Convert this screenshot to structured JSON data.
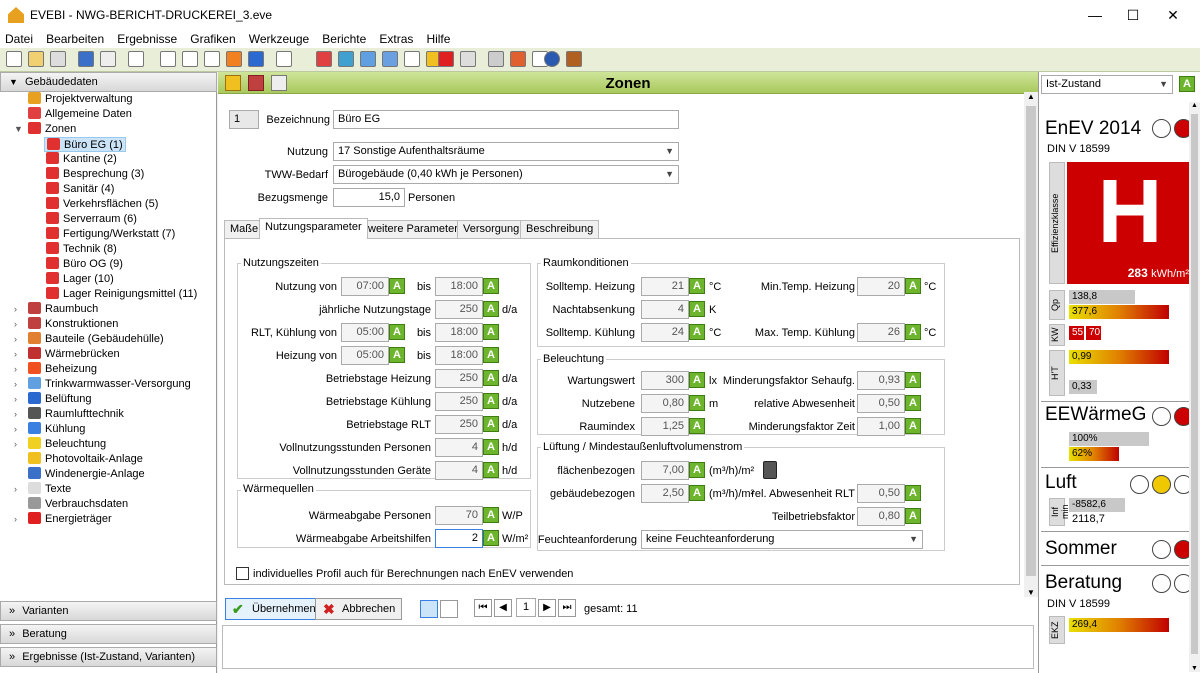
{
  "app": {
    "title": "EVEBI - NWG-BERICHT-DRUCKEREI_3.eve"
  },
  "menu": [
    "Datei",
    "Bearbeiten",
    "Ergebnisse",
    "Grafiken",
    "Werkzeuge",
    "Berichte",
    "Extras",
    "Hilfe"
  ],
  "sidebar": {
    "header": "Gebäudedaten",
    "tree": [
      "Projektverwaltung",
      "Allgemeine Daten",
      "Zonen",
      "Büro EG (1)",
      "Kantine (2)",
      "Besprechung (3)",
      "Sanitär (4)",
      "Verkehrsflächen (5)",
      "Serverraum (6)",
      "Fertigung/Werkstatt (7)",
      "Technik (8)",
      "Büro OG (9)",
      "Lager (10)",
      "Lager Reinigungsmittel (11)",
      "Raumbuch",
      "Konstruktionen",
      "Bauteile (Gebäudehülle)",
      "Wärmebrücken",
      "Beheizung",
      "Trinkwarmwasser-Versorgung",
      "Belüftung",
      "Raumlufttechnik",
      "Kühlung",
      "Beleuchtung",
      "Photovoltaik-Anlage",
      "Windenergie-Anlage",
      "Texte",
      "Verbrauchsdaten",
      "Energieträger"
    ],
    "bottom": [
      "Varianten",
      "Beratung",
      "Ergebnisse (Ist-Zustand, Varianten)"
    ]
  },
  "main": {
    "title": "Zonen",
    "zone_number": "1",
    "bezeichnung_label": "Bezeichnung",
    "bezeichnung_value": "Büro EG",
    "nutzung_label": "Nutzung",
    "nutzung_value": "17 Sonstige Aufenthaltsräume",
    "tww_label": "TWW-Bedarf",
    "tww_value": "Bürogebäude (0,40 kWh je Personen)",
    "bezug_label": "Bezugsmenge",
    "bezug_value": "15,0",
    "bezug_unit": "Personen",
    "tabs": [
      "Maße",
      "Nutzungsparameter",
      "weitere Parameter",
      "Versorgung",
      "Beschreibung"
    ],
    "nutzungszeiten": {
      "title": "Nutzungszeiten",
      "nutzung_von_label": "Nutzung von",
      "nutzung_von": "07:00",
      "bis1": "bis",
      "nutzung_bis": "18:00",
      "nutzungstage_label": "jährliche Nutzungstage",
      "nutzungstage": "250",
      "unit_da": "d/a",
      "rlt_label": "RLT, Kühlung von",
      "rlt_von": "05:00",
      "bis2": "bis",
      "rlt_bis": "18:00",
      "heizung_label": "Heizung von",
      "heizung_von": "05:00",
      "bis3": "bis",
      "heizung_bis": "18:00",
      "bt_heizung_label": "Betriebstage Heizung",
      "bt_heizung": "250",
      "bt_kuehlung_label": "Betriebstage Kühlung",
      "bt_kuehlung": "250",
      "bt_rlt_label": "Betriebstage RLT",
      "bt_rlt": "250",
      "vn_personen_label": "Vollnutzungsstunden Personen",
      "vn_personen": "4",
      "unit_hd": "h/d",
      "vn_geraete_label": "Vollnutzungsstunden Geräte",
      "vn_geraete": "4"
    },
    "waermequellen": {
      "title": "Wärmequellen",
      "personen_label": "Wärmeabgabe Personen",
      "personen": "70",
      "personen_unit": "W/P",
      "arbeitshilfen_label": "Wärmeabgabe Arbeitshilfen",
      "arbeitshilfen": "2",
      "arbeitshilfen_unit": "W/m²"
    },
    "raumkonditionen": {
      "title": "Raumkonditionen",
      "soll_heizung_label": "Solltemp. Heizung",
      "soll_heizung": "21",
      "unit_c": "°C",
      "min_heizung_label": "Min.Temp. Heizung",
      "min_heizung": "20",
      "nachtabsenkung_label": "Nachtabsenkung",
      "nachtabsenkung": "4",
      "unit_k": "K",
      "soll_kuehlung_label": "Solltemp. Kühlung",
      "soll_kuehlung": "24",
      "max_kuehlung_label": "Max. Temp. Kühlung",
      "max_kuehlung": "26"
    },
    "beleuchtung": {
      "title": "Beleuchtung",
      "wartungswert_label": "Wartungswert",
      "wartungswert": "300",
      "unit_lx": "lx",
      "minderung_seh_label": "Minderungsfaktor Sehaufg.",
      "minderung_seh": "0,93",
      "nutzebene_label": "Nutzebene",
      "nutzebene": "0,80",
      "unit_m": "m",
      "rel_abw_label": "relative Abwesenheit",
      "rel_abw": "0,50",
      "raumindex_label": "Raumindex",
      "raumindex": "1,25",
      "minderung_zeit_label": "Minderungsfaktor Zeit",
      "minderung_zeit": "1,00"
    },
    "lueftung": {
      "title": "Lüftung / Mindestaußenluftvolumenstrom",
      "flaeche_label": "flächenbezogen",
      "flaeche": "7,00",
      "unit": "(m³/h)/m²",
      "gebaeude_label": "gebäudebezogen",
      "gebaeude": "2,50",
      "rel_abw_rlt_label": "rel. Abwesenheit RLT",
      "rel_abw_rlt": "0,50",
      "teilbetrieb_label": "Teilbetriebsfaktor",
      "teilbetrieb": "0,80",
      "feuchte_label": "Feuchteanforderung",
      "feuchte": "keine Feuchteanforderung"
    },
    "checkbox_label": "individuelles Profil auch für Berechnungen nach EnEV verwenden",
    "ok_label": "Übernehmen",
    "cancel_label": "Abbrechen",
    "page": "1",
    "total": "gesamt: 11",
    "a_label": "A"
  },
  "rightpanel": {
    "state": "Ist-Zustand",
    "enev": {
      "title": "EnEV 2014",
      "norm": "DIN V 18599",
      "klasse_label": "Effizienzklasse",
      "klasse": "H",
      "value": "283",
      "unit": "kWh/m²",
      "qp_label": "Qp",
      "qp1": "138,8",
      "qp2": "377,6",
      "kw_label": "KW",
      "kw1": "55",
      "kw2": "70",
      "ht_label": "H'T",
      "ht1": "0,99",
      "ht2": "0,33"
    },
    "eew": {
      "title": "EEWärmeG",
      "v1": "100%",
      "v2": "62%"
    },
    "luft": {
      "title": "Luft",
      "label": "Inf min",
      "v1": "-8582,6",
      "v2": "2118,7"
    },
    "sommer": {
      "title": "Sommer"
    },
    "beratung": {
      "title": "Beratung",
      "norm": "DIN V 18599",
      "label": "EKZ",
      "v1": "269,4"
    }
  },
  "colors": {
    "accent_green": "#6eb52e",
    "header_green": "#a8c85c",
    "class_red": "#cc0000"
  }
}
